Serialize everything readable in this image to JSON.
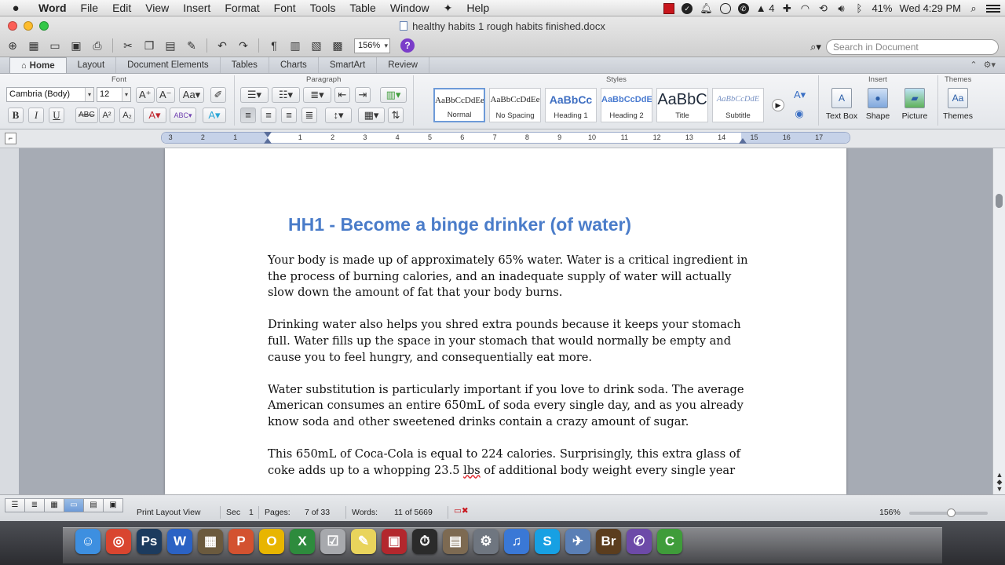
{
  "menubar": {
    "app_name": "Word",
    "items": [
      "File",
      "Edit",
      "View",
      "Insert",
      "Format",
      "Font",
      "Tools",
      "Table",
      "Window",
      "Help"
    ],
    "status": {
      "battery": "41%",
      "clock": "Wed 4:29 PM",
      "adobe_count": "4"
    }
  },
  "window": {
    "title": "healthy habits 1 rough habits finished.docx",
    "zoom": "156%",
    "search_placeholder": "Search in Document"
  },
  "ribbon": {
    "tabs": [
      "Home",
      "Layout",
      "Document Elements",
      "Tables",
      "Charts",
      "SmartArt",
      "Review"
    ],
    "groups": {
      "font": "Font",
      "paragraph": "Paragraph",
      "styles": "Styles",
      "insert": "Insert",
      "themes": "Themes"
    },
    "font_name": "Cambria (Body)",
    "font_size": "12",
    "styles": [
      {
        "sample": "AaBbCcDdEe",
        "name": "Normal"
      },
      {
        "sample": "AaBbCcDdEe",
        "name": "No Spacing"
      },
      {
        "sample": "AaBbCc",
        "name": "Heading 1"
      },
      {
        "sample": "AaBbCcDdE",
        "name": "Heading 2"
      },
      {
        "sample": "AaBbC",
        "name": "Title"
      },
      {
        "sample": "AaBbCcDdE",
        "name": "Subtitle"
      }
    ],
    "insert_buttons": [
      "Text Box",
      "Shape",
      "Picture"
    ],
    "themes_button": "Themes"
  },
  "document": {
    "heading": "HH1 - Become a binge drinker (of water)",
    "paragraphs": [
      "Your body is made up of approximately 65% water. Water is a critical ingredient in the process of burning calories, and an inadequate supply of water will actually slow down the amount of fat that your body burns.",
      "Drinking water also helps you shred extra pounds because it keeps your stomach full. Water fills up the space in your stomach that would normally be empty and cause you to feel hungry, and consequentially eat more.",
      "Water substitution is particularly important if you love to drink soda. The average American consumes an entire 650mL of soda every single day, and as you already know soda and other sweetened drinks contain a crazy amount of sugar."
    ],
    "para4_start": "This 650mL of Coca-Cola is equal to 224 calories. Surprisingly, this extra glass of coke adds up to a whopping 23.5 ",
    "para4_misspelled": "lbs",
    "para4_end": " of additional body weight every single year"
  },
  "statusbar": {
    "view": "Print Layout View",
    "sec_label": "Sec",
    "sec_value": "1",
    "pages_label": "Pages:",
    "pages_value": "7 of 33",
    "words_label": "Words:",
    "words_value": "11 of 5669",
    "zoom": "156%"
  },
  "ruler_ticks": [
    "3",
    "2",
    "1",
    "1",
    "2",
    "3",
    "4",
    "5",
    "6",
    "7",
    "8",
    "9",
    "10",
    "11",
    "12",
    "13",
    "14",
    "15",
    "16",
    "17"
  ],
  "dock": [
    {
      "name": "finder",
      "glyph": "☺",
      "color": "#3d8fe0"
    },
    {
      "name": "chrome",
      "glyph": "◎",
      "color": "#d9452f"
    },
    {
      "name": "photoshop",
      "glyph": "Ps",
      "color": "#1c3b5e"
    },
    {
      "name": "word",
      "glyph": "W",
      "color": "#2b62c4"
    },
    {
      "name": "toolbox",
      "glyph": "▦",
      "color": "#6b5a3e"
    },
    {
      "name": "powerpoint",
      "glyph": "P",
      "color": "#d35230"
    },
    {
      "name": "outlook",
      "glyph": "O",
      "color": "#e8b500"
    },
    {
      "name": "excel",
      "glyph": "X",
      "color": "#2e8b3d"
    },
    {
      "name": "checklist",
      "glyph": "☑",
      "color": "#a7a9ad"
    },
    {
      "name": "notes",
      "glyph": "✎",
      "color": "#e9d45c"
    },
    {
      "name": "photo-booth",
      "glyph": "▣",
      "color": "#b3272d"
    },
    {
      "name": "timer",
      "glyph": "⏱",
      "color": "#2b2b2b"
    },
    {
      "name": "camera",
      "glyph": "▤",
      "color": "#7d6a52"
    },
    {
      "name": "system-preferences",
      "glyph": "⚙",
      "color": "#6f7680"
    },
    {
      "name": "itunes",
      "glyph": "♫",
      "color": "#3a78d6"
    },
    {
      "name": "skype",
      "glyph": "S",
      "color": "#17a0e3"
    },
    {
      "name": "preview",
      "glyph": "✈",
      "color": "#5a7fb5"
    },
    {
      "name": "bridge",
      "glyph": "Br",
      "color": "#5b3d1e"
    },
    {
      "name": "viber",
      "glyph": "✆",
      "color": "#6d4aa8"
    },
    {
      "name": "camtasia",
      "glyph": "C",
      "color": "#3f9c3a"
    }
  ]
}
